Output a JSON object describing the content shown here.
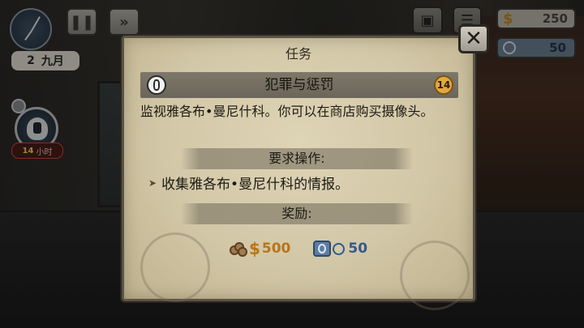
{
  "hud": {
    "date_day": "2",
    "date_month": "九月",
    "money": "250",
    "money_symbol": "$",
    "reputation": "50"
  },
  "left_panel": {
    "timer_value": "14",
    "timer_unit": "小时"
  },
  "dialog": {
    "title": "任务",
    "quest_title": "犯罪与惩罚",
    "quest_level": "14",
    "description": "监视雅各布•曼尼什科。你可以在商店购买摄像头。",
    "requirements_header": "要求操作:",
    "requirement_item": "收集雅各布•曼尼什科的情报。",
    "rewards_header": "奖励:",
    "reward_money_symbol": "$",
    "reward_money": "500",
    "reward_reputation": "50",
    "close_label": "✕"
  },
  "colors": {
    "panel": "#d2c7a6",
    "banner": "#6b665a",
    "money": "#b8741a",
    "reputation": "#2f5a8f",
    "level_badge": "#e1a940"
  },
  "icons": {
    "pause": "pause-icon",
    "fast_forward": "fast-forward-icon",
    "inventory": "bag-icon",
    "close": "close-icon"
  }
}
